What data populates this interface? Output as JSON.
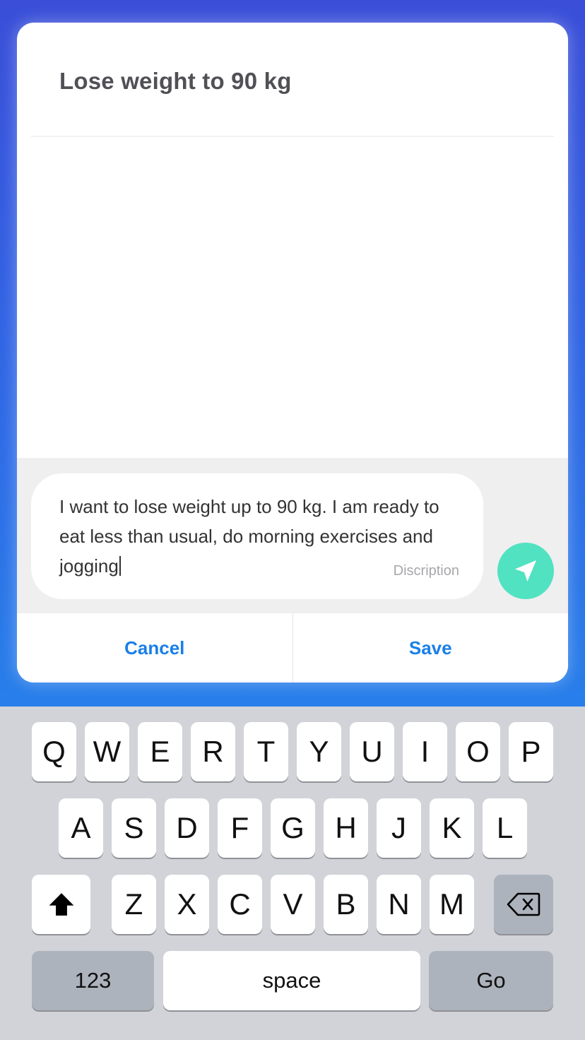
{
  "dialog": {
    "title": "Lose weight to 90 kg",
    "description_text": "I want to lose weight up to 90 kg. I am ready to eat less than usual, do morning exercises and jogging",
    "description_hint": "Discription",
    "send_icon": "navigation-arrow-icon",
    "cancel_label": "Cancel",
    "save_label": "Save"
  },
  "colors": {
    "accent": "#1a7fe8",
    "send_button": "#51e2c1",
    "background_top": "#3a4ed8",
    "background_bottom": "#1f96ee"
  },
  "keyboard": {
    "row1": [
      "Q",
      "W",
      "E",
      "R",
      "T",
      "Y",
      "U",
      "I",
      "O",
      "P"
    ],
    "row2": [
      "A",
      "S",
      "D",
      "F",
      "G",
      "H",
      "J",
      "K",
      "L"
    ],
    "row3": [
      "Z",
      "X",
      "C",
      "V",
      "B",
      "N",
      "M"
    ],
    "shift_icon": "shift-arrow-icon",
    "delete_icon": "backspace-icon",
    "numbers_label": "123",
    "space_label": "space",
    "go_label": "Go"
  }
}
